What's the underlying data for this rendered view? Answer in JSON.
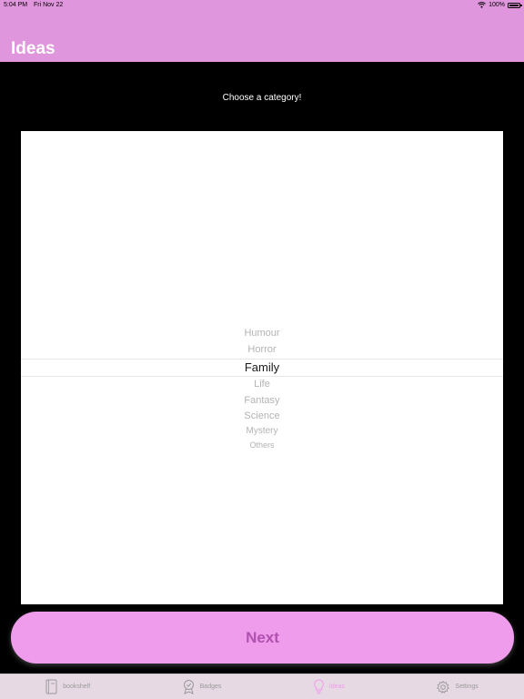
{
  "status_bar": {
    "time": "5:04 PM",
    "date": "Fri Nov 22",
    "battery": "100%"
  },
  "header": {
    "title": "Ideas",
    "background_color": "#e096dc"
  },
  "prompt": "Choose a category!",
  "picker": {
    "options": [
      "Humour",
      "Horror",
      "Family",
      "Life",
      "Fantasy",
      "Science",
      "Mystery",
      "Others"
    ],
    "selected": "Family"
  },
  "next_button": {
    "label": "Next",
    "color": "#f09cec"
  },
  "tabs": [
    {
      "label": "bookshelf",
      "icon": "book-icon",
      "active": false
    },
    {
      "label": "Badges",
      "icon": "badge-icon",
      "active": false
    },
    {
      "label": "Ideas",
      "icon": "lightbulb-icon",
      "active": true
    },
    {
      "label": "Settings",
      "icon": "gear-icon",
      "active": false
    }
  ]
}
